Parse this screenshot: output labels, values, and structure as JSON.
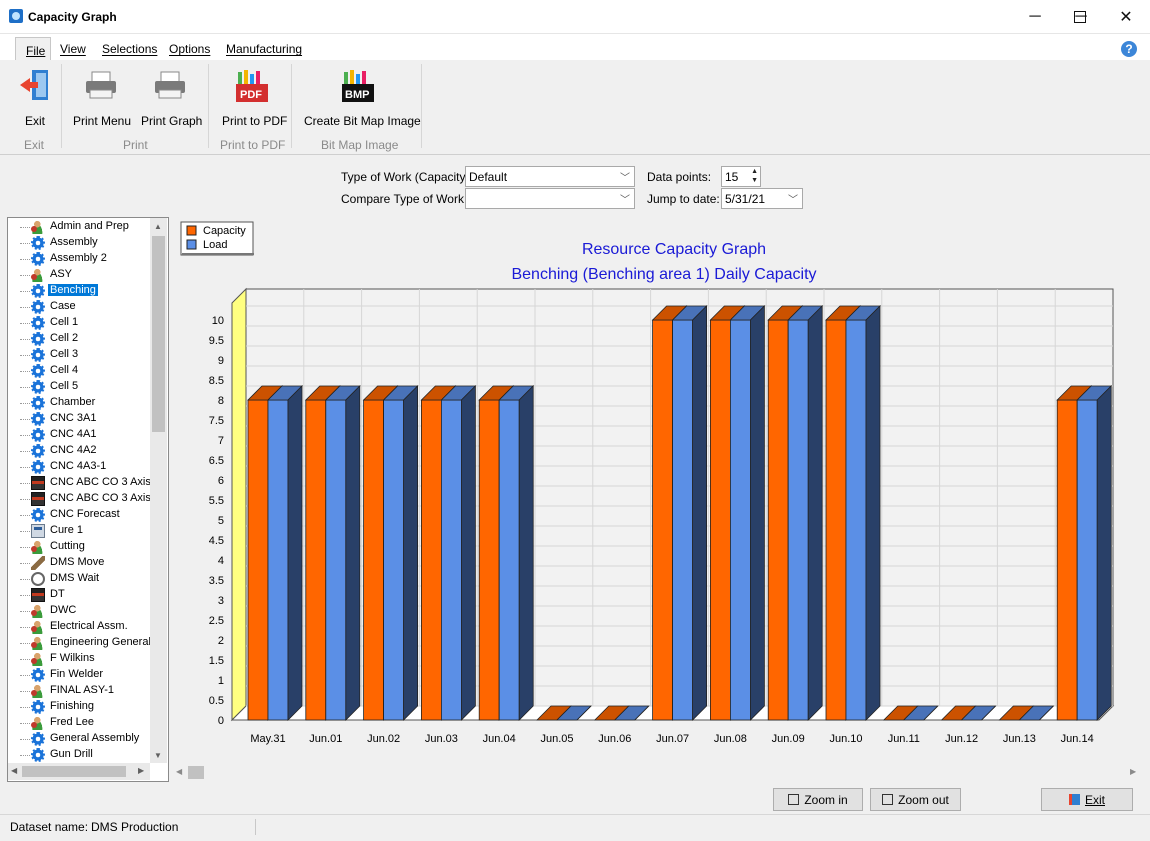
{
  "window": {
    "title": "Capacity Graph",
    "minimize": "─",
    "maximize": "☐",
    "close": "✕"
  },
  "menu": {
    "file": "File",
    "view": "View",
    "selections": "Selections",
    "options": "Options",
    "manufacturing": "Manufacturing",
    "help": "?"
  },
  "ribbon": {
    "exit": "Exit",
    "print_menu": "Print Menu",
    "print_graph": "Print Graph",
    "print_pdf": "Print to PDF",
    "create_bmp": "Create Bit Map Image",
    "pdf_badge": "PDF",
    "bmp_badge": "BMP",
    "groups": {
      "exit": "Exit",
      "print": "Print",
      "pdf": "Print to PDF",
      "bmp": "Bit Map Image"
    }
  },
  "filters": {
    "type_of_work_label": "Type of Work (Capacity):",
    "type_of_work_value": "Default",
    "compare_label": "Compare Type of Work:",
    "compare_value": "",
    "data_points_label": "Data points:",
    "data_points_value": "15",
    "jump_label": "Jump to date:",
    "jump_value": "5/31/21"
  },
  "tree": {
    "items": [
      {
        "label": "Admin and Prep",
        "icon": "people"
      },
      {
        "label": "Assembly",
        "icon": "gear"
      },
      {
        "label": "Assembly 2",
        "icon": "gear"
      },
      {
        "label": "ASY",
        "icon": "people"
      },
      {
        "label": "Benching",
        "icon": "gear",
        "selected": true
      },
      {
        "label": "Case",
        "icon": "gear"
      },
      {
        "label": "Cell 1",
        "icon": "gear"
      },
      {
        "label": "Cell 2",
        "icon": "gear"
      },
      {
        "label": "Cell 3",
        "icon": "gear"
      },
      {
        "label": "Cell 4",
        "icon": "gear"
      },
      {
        "label": "Cell 5",
        "icon": "gear"
      },
      {
        "label": "Chamber",
        "icon": "gear"
      },
      {
        "label": "CNC 3A1",
        "icon": "gear"
      },
      {
        "label": "CNC 4A1",
        "icon": "gear"
      },
      {
        "label": "CNC 4A2",
        "icon": "gear"
      },
      {
        "label": "CNC 4A3-1",
        "icon": "gear"
      },
      {
        "label": "CNC ABC CO 3 Axis",
        "icon": "machine"
      },
      {
        "label": "CNC ABC CO 3 Axis",
        "icon": "machine"
      },
      {
        "label": "CNC Forecast",
        "icon": "gear"
      },
      {
        "label": "Cure 1",
        "icon": "cure"
      },
      {
        "label": "Cutting",
        "icon": "people"
      },
      {
        "label": "DMS Move",
        "icon": "move"
      },
      {
        "label": "DMS Wait",
        "icon": "clock"
      },
      {
        "label": "DT",
        "icon": "machine"
      },
      {
        "label": "DWC",
        "icon": "people"
      },
      {
        "label": "Electrical Assm.",
        "icon": "people"
      },
      {
        "label": "Engineering General",
        "icon": "people"
      },
      {
        "label": "F Wilkins",
        "icon": "people"
      },
      {
        "label": "Fin Welder",
        "icon": "gear"
      },
      {
        "label": "FINAL ASY-1",
        "icon": "people"
      },
      {
        "label": "Finishing",
        "icon": "gear"
      },
      {
        "label": "Fred Lee",
        "icon": "people"
      },
      {
        "label": "General Assembly",
        "icon": "gear"
      },
      {
        "label": "Gun Drill",
        "icon": "gear"
      }
    ]
  },
  "chart_data": {
    "type": "bar",
    "title": "Resource Capacity Graph",
    "subtitle": "Benching (Benching area 1)  Daily Capacity",
    "categories": [
      "May.31",
      "Jun.01",
      "Jun.02",
      "Jun.03",
      "Jun.04",
      "Jun.05",
      "Jun.06",
      "Jun.07",
      "Jun.08",
      "Jun.09",
      "Jun.10",
      "Jun.11",
      "Jun.12",
      "Jun.13",
      "Jun.14"
    ],
    "series": [
      {
        "name": "Capacity",
        "color": "#ff6600",
        "values": [
          8,
          8,
          8,
          8,
          8,
          0,
          0,
          10,
          10,
          10,
          10,
          0,
          0,
          0,
          8
        ]
      },
      {
        "name": "Load",
        "color": "#5b8fe6",
        "values": [
          8,
          8,
          8,
          8,
          8,
          0,
          0,
          10,
          10,
          10,
          10,
          0,
          0,
          0,
          8
        ]
      }
    ],
    "ylim": [
      0,
      10
    ],
    "yticks": [
      "0",
      "0.5",
      "1",
      "1.5",
      "2",
      "2.5",
      "3",
      "3.5",
      "4",
      "4.5",
      "5",
      "5.5",
      "6",
      "6.5",
      "7",
      "7.5",
      "8",
      "8.5",
      "9",
      "9.5",
      "10"
    ],
    "grid": true,
    "legend": "top-left"
  },
  "buttons": {
    "zoom_in": "Zoom in",
    "zoom_out": "Zoom out",
    "exit": "Exit"
  },
  "status": {
    "dataset_label": "Dataset name:",
    "dataset_value": "DMS Production"
  }
}
